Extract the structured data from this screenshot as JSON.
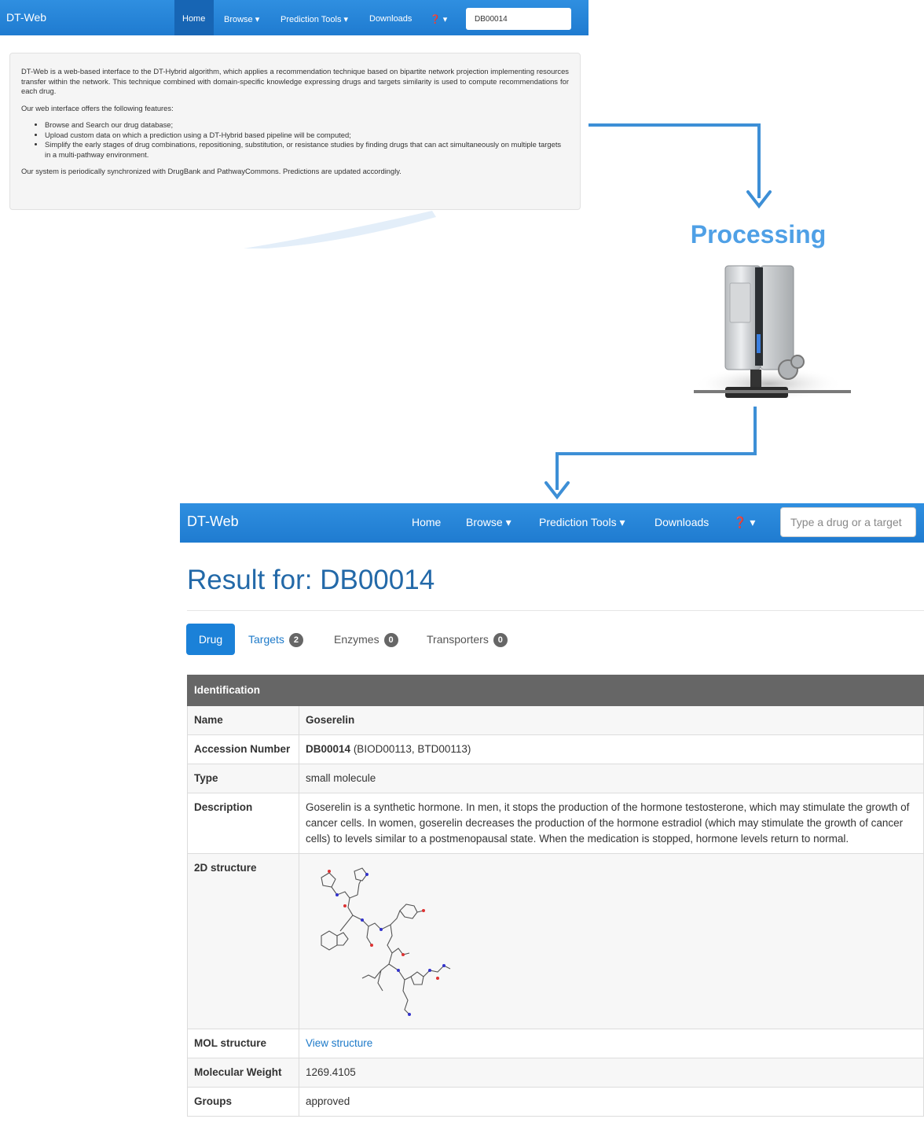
{
  "small_screen": {
    "brand": "DT-Web",
    "nav": {
      "home": "Home",
      "browse": "Browse ▾",
      "prediction_tools": "Prediction Tools ▾",
      "downloads": "Downloads",
      "help": "❓ ▾"
    },
    "search_value": "DB00014",
    "intro": {
      "paragraph1": "DT-Web is a web-based interface to the DT-Hybrid algorithm, which applies a recommendation technique based on bipartite network projection implementing resources transfer within the network. This technique combined with domain-specific knowledge expressing drugs and targets similarity is used to compute recommendations for each drug.",
      "paragraph2": "Our web interface offers the following features:",
      "features": [
        "Browse and Search our drug database;",
        "Upload custom data on which a prediction using a DT-Hybrid based pipeline will be computed;",
        "Simplify the early stages of drug combinations, repositioning, substitution, or resistance studies by finding drugs that can act simultaneously on multiple targets in a multi-pathway environment."
      ],
      "paragraph3": "Our system is periodically synchronized with DrugBank and PathwayCommons. Predictions are updated accordingly."
    }
  },
  "processing_label": "Processing",
  "big_screen": {
    "brand": "DT-Web",
    "nav": {
      "home": "Home",
      "browse": "Browse ▾",
      "prediction_tools": "Prediction Tools ▾",
      "downloads": "Downloads",
      "help": "❓ ▾"
    },
    "search_placeholder": "Type a drug or a target",
    "title": "Result for: DB00014",
    "tabs": {
      "drug": "Drug",
      "targets": "Targets",
      "targets_count": "2",
      "enzymes": "Enzymes",
      "enzymes_count": "0",
      "transporters": "Transporters",
      "transporters_count": "0"
    },
    "table": {
      "header": "Identification",
      "name_label": "Name",
      "name_value": "Goserelin",
      "accession_label": "Accession Number",
      "accession_id": "DB00014",
      "accession_alt": "(BIOD00113, BTD00113)",
      "type_label": "Type",
      "type_value": "small molecule",
      "description_label": "Description",
      "description_value": "Goserelin is a synthetic hormone. In men, it stops the production of the hormone testosterone, which may stimulate the growth of cancer cells. In women, goserelin decreases the production of the hormone estradiol (which may stimulate the growth of cancer cells) to levels similar to a postmenopausal state. When the medication is stopped, hormone levels return to normal.",
      "structure_label": "2D structure",
      "mol_label": "MOL structure",
      "mol_link": "View structure",
      "weight_label": "Molecular Weight",
      "weight_value": "1269.4105",
      "groups_label": "Groups",
      "groups_value": "approved"
    }
  },
  "colors": {
    "navbar": "#1f7bd0",
    "arrow": "#3d8fd6",
    "title": "#2369a8",
    "table_header": "#666666"
  }
}
